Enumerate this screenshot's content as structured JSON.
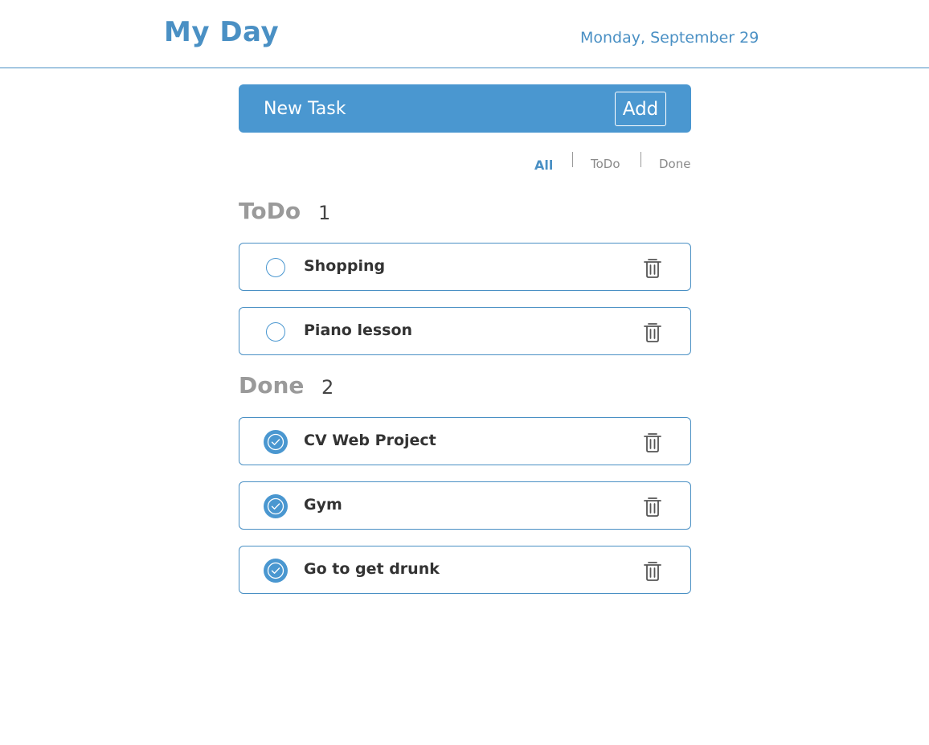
{
  "header": {
    "title": "My Day",
    "date": "Monday, September 29"
  },
  "new_task": {
    "placeholder": "New Task",
    "value": "",
    "add_label": "Add"
  },
  "filters": {
    "items": [
      "All",
      "ToDo",
      "Done"
    ],
    "active": "All"
  },
  "sections": {
    "todo": {
      "title": "ToDo",
      "count": "1",
      "tasks": [
        {
          "label": "Shopping",
          "done": false
        },
        {
          "label": "Piano lesson",
          "done": false
        }
      ]
    },
    "done": {
      "title": "Done",
      "count": "2",
      "tasks": [
        {
          "label": "CV Web Project",
          "done": true
        },
        {
          "label": "Gym",
          "done": true
        },
        {
          "label": "Go to get drunk",
          "done": true
        }
      ]
    }
  },
  "icons": {
    "check": "circle-check-icon",
    "trash": "trash-icon"
  },
  "colors": {
    "accent": "#4a97d0",
    "title": "#4a90c4",
    "muted": "#9a9a9a",
    "text": "#333333"
  }
}
